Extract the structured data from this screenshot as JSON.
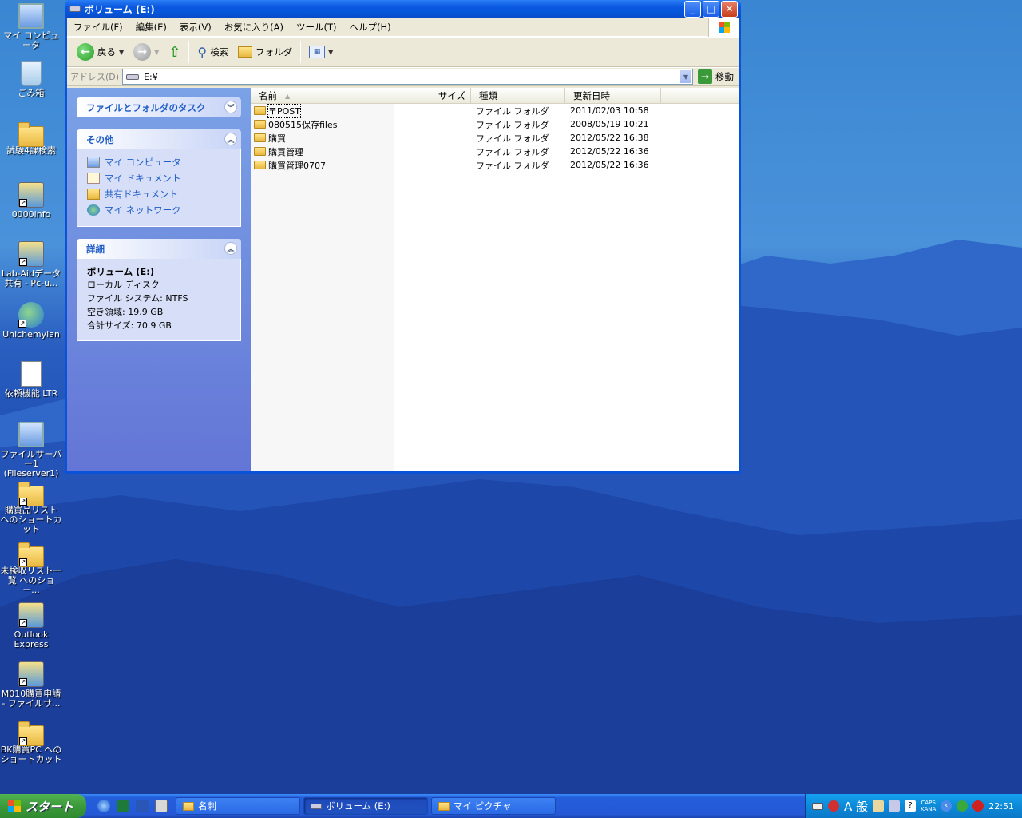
{
  "desktop_icons": [
    {
      "label": "マイ コンピュータ",
      "icon": "my-computer-icon",
      "shortcut": false
    },
    {
      "label": "ごみ箱",
      "icon": "recycle-bin-icon",
      "shortcut": false
    },
    {
      "label": "試験4課検索",
      "icon": "folder-icon",
      "shortcut": false
    },
    {
      "label": "0000info",
      "icon": "network-share-icon",
      "shortcut": true
    },
    {
      "label": "Lab-Aidデータ共有 - Pc-u...",
      "icon": "network-share-icon",
      "shortcut": true
    },
    {
      "label": "Unichemylan",
      "icon": "network-icon",
      "shortcut": true
    },
    {
      "label": "依頼機能 LTR",
      "icon": "document-icon",
      "shortcut": false
    },
    {
      "label": "ファイルサーバー1 (Fileserver1)",
      "icon": "server-icon",
      "shortcut": false
    },
    {
      "label": "購買品リスト へのショートカット",
      "icon": "folder-icon",
      "shortcut": true
    },
    {
      "label": "未検収リスト一覧 へのショー...",
      "icon": "folder-icon",
      "shortcut": true
    },
    {
      "label": "Outlook Express",
      "icon": "outlook-express-icon",
      "shortcut": true
    },
    {
      "label": "M010購買申請 - ファイルサ...",
      "icon": "network-share-icon",
      "shortcut": true
    },
    {
      "label": "BK購買PC へのショートカット",
      "icon": "folder-icon",
      "shortcut": true
    }
  ],
  "window": {
    "title": "ボリューム (E:)",
    "menu": [
      "ファイル(F)",
      "編集(E)",
      "表示(V)",
      "お気に入り(A)",
      "ツール(T)",
      "ヘルプ(H)"
    ],
    "toolbar": {
      "back": "戻る",
      "search": "検索",
      "folders": "フォルダ"
    },
    "address": {
      "label": "アドレス(D)",
      "value": "E:¥",
      "go": "移動"
    },
    "taskpane": {
      "tasks_title": "ファイルとフォルダのタスク",
      "other_title": "その他",
      "other_links": [
        "マイ コンピュータ",
        "マイ ドキュメント",
        "共有ドキュメント",
        "マイ ネットワーク"
      ],
      "details_title": "詳細",
      "details": {
        "name": "ボリューム (E:)",
        "type": "ローカル ディスク",
        "filesystem": "ファイル システム: NTFS",
        "free": "空き領域: 19.9 GB",
        "total": "合計サイズ: 70.9 GB"
      }
    },
    "columns": [
      "名前",
      "サイズ",
      "種類",
      "更新日時"
    ],
    "files": [
      {
        "name": "〒POST",
        "size": "",
        "type": "ファイル フォルダ",
        "modified": "2011/02/03 10:58",
        "selected": true
      },
      {
        "name": "080515保存files",
        "size": "",
        "type": "ファイル フォルダ",
        "modified": "2008/05/19 10:21",
        "selected": false
      },
      {
        "name": "購買",
        "size": "",
        "type": "ファイル フォルダ",
        "modified": "2012/05/22 16:38",
        "selected": false
      },
      {
        "name": "購買管理",
        "size": "",
        "type": "ファイル フォルダ",
        "modified": "2012/05/22 16:36",
        "selected": false
      },
      {
        "name": "購買管理0707",
        "size": "",
        "type": "ファイル フォルダ",
        "modified": "2012/05/22 16:36",
        "selected": false
      }
    ]
  },
  "taskbar": {
    "start": "スタート",
    "tasks": [
      {
        "label": "名刺",
        "active": false
      },
      {
        "label": "ボリューム (E:)",
        "active": true
      },
      {
        "label": "マイ ピクチャ",
        "active": false
      }
    ],
    "ime": "A 般",
    "caps": "CAPS",
    "kana": "KANA",
    "clock": "22:51"
  },
  "colors": {
    "titlebar": "#0a58e0",
    "taskpane_link": "#215dc6",
    "start_button": "#3b9a3b"
  }
}
